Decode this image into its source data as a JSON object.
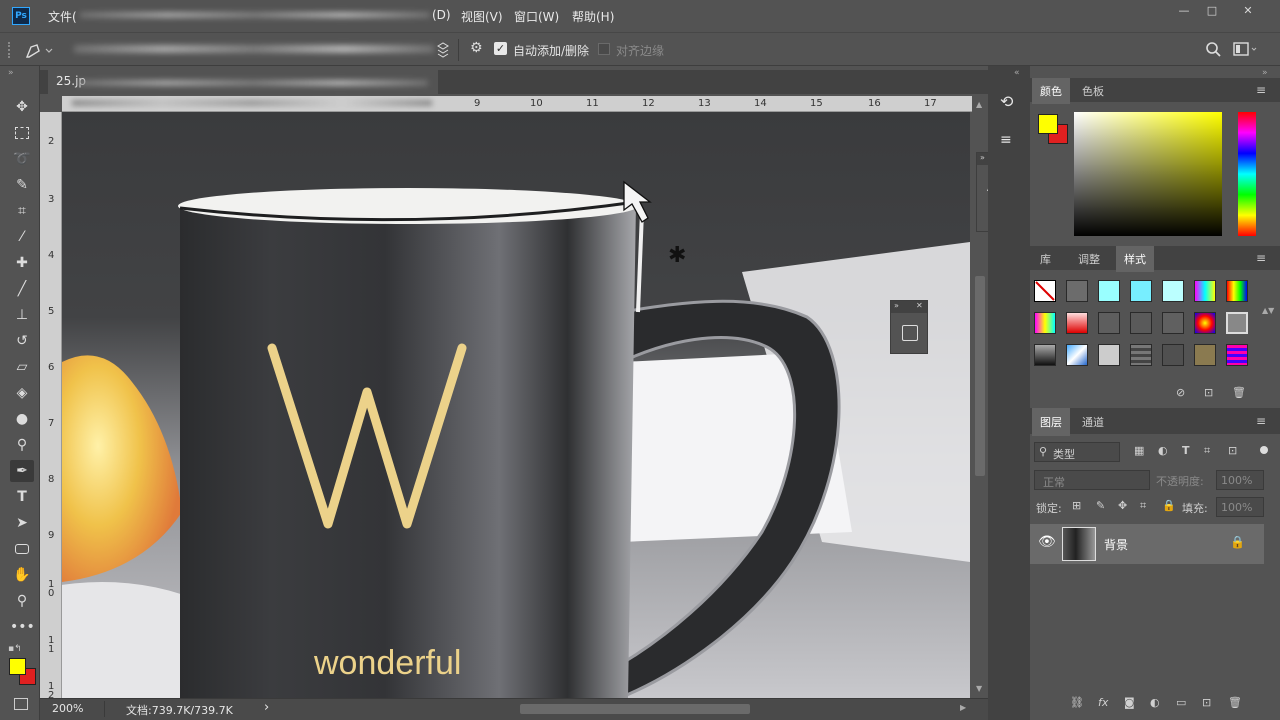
{
  "app": {
    "logo": "Ps"
  },
  "menubar": {
    "file": "文件(",
    "items": [
      "(D)",
      "视图(V)",
      "窗口(W)",
      "帮助(H)"
    ],
    "window_controls": {
      "minimize": "—",
      "restore": "□",
      "close": "✕"
    }
  },
  "options_bar": {
    "auto_add_delete_label": "自动添加/删除",
    "auto_add_delete_checked": true,
    "align_edges_label": "对齐边缘",
    "align_edges_checked": false
  },
  "document": {
    "tab_label": "25.jp",
    "mug_text_big": "W",
    "mug_text_word": "wonderful"
  },
  "rulers": {
    "top": [
      "9",
      "10",
      "11",
      "12",
      "13",
      "14",
      "15",
      "16",
      "17"
    ],
    "left": [
      "2",
      "3",
      "4",
      "5",
      "6",
      "7",
      "8",
      "9",
      "1 0",
      "1 1",
      "1 2"
    ]
  },
  "status": {
    "zoom": "200%",
    "doc_info": "文档:739.7K/739.7K",
    "arrow": "›"
  },
  "color_panel": {
    "tabs": [
      "颜色",
      "色板"
    ],
    "active_tab": "颜色",
    "foreground": "#ffff00",
    "background": "#e02020"
  },
  "styles_panel": {
    "tabs": [
      "库",
      "调整",
      "样式"
    ],
    "active_tab": "样式"
  },
  "layers_panel": {
    "tabs": [
      "图层",
      "通道"
    ],
    "active_tab": "图层",
    "filter_label": "类型",
    "blend_mode": "正常",
    "opacity_label": "不透明度:",
    "opacity_value": "100%",
    "lock_label": "锁定:",
    "fill_label": "填充:",
    "fill_value": "100%",
    "layers": [
      {
        "name": "背景",
        "visible": true,
        "locked": true
      }
    ]
  },
  "char_panel": {
    "char_icon": "A|",
    "para_icon": "¶"
  },
  "tools": [
    "move",
    "marquee",
    "lasso",
    "quick-select",
    "crop",
    "eyedropper",
    "healing",
    "brush",
    "stamp",
    "history-brush",
    "eraser",
    "paint-bucket",
    "blur",
    "dodge",
    "pen",
    "type",
    "path-select",
    "rectangle",
    "hand",
    "zoom",
    "more"
  ]
}
